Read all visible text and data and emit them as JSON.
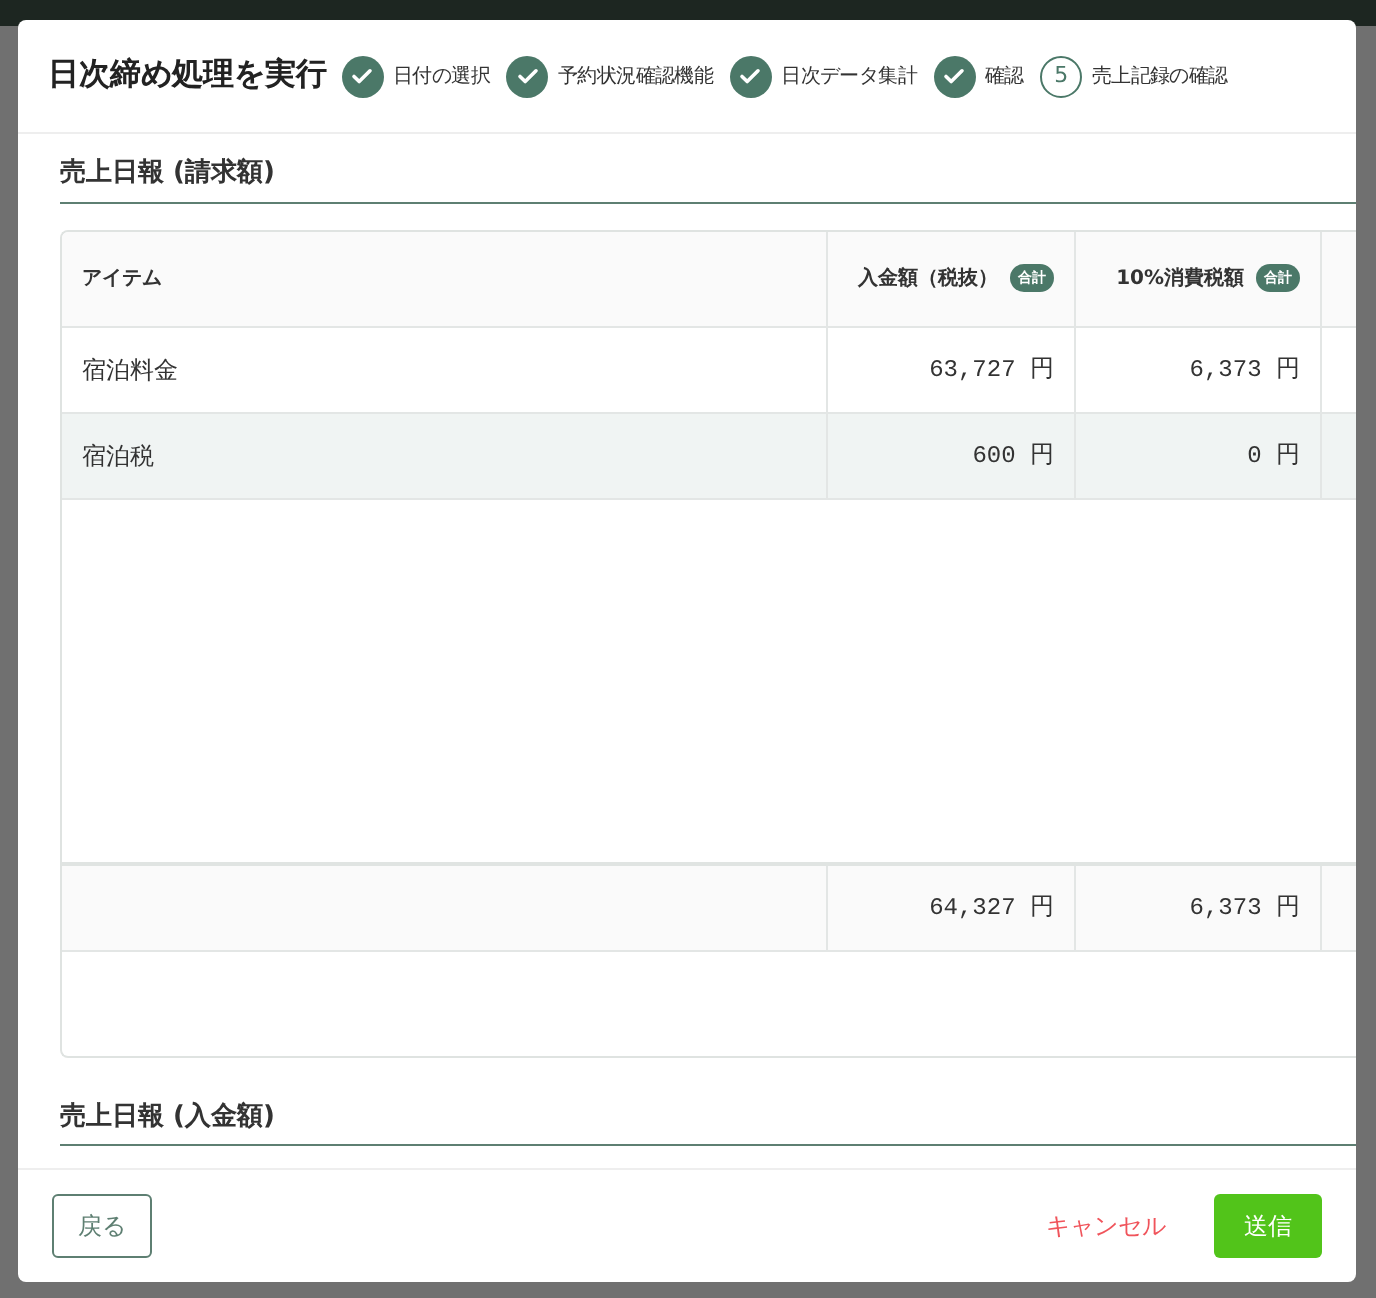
{
  "dialog": {
    "title": "日次締め処理を実行",
    "steps": [
      {
        "label": "日付の選択",
        "done": true
      },
      {
        "label": "予約状況確認機能",
        "done": true
      },
      {
        "label": "日次データ集計",
        "done": true
      },
      {
        "label": "確認",
        "done": true
      },
      {
        "label": "売上記録の確認",
        "done": false,
        "number": "5"
      }
    ],
    "sections": [
      {
        "title": "売上日報 (請求額)",
        "table": {
          "columns": [
            {
              "label": "アイテム"
            },
            {
              "label": "入金額（税抜）",
              "badge": "合計"
            },
            {
              "label": "10%消費税額",
              "badge": "合計"
            }
          ],
          "rows": [
            {
              "item": "宿泊料金",
              "amount": "63,727 円",
              "tax": "6,373 円",
              "selected": false
            },
            {
              "item": "宿泊税",
              "amount": "600 円",
              "tax": "0 円",
              "selected": true
            }
          ],
          "totals": {
            "amount": "64,327 円",
            "tax": "6,373 円"
          }
        }
      },
      {
        "title": "売上日報 (入金額)"
      }
    ],
    "buttons": {
      "back": "戻る",
      "cancel": "キャンセル",
      "submit": "送信"
    }
  }
}
